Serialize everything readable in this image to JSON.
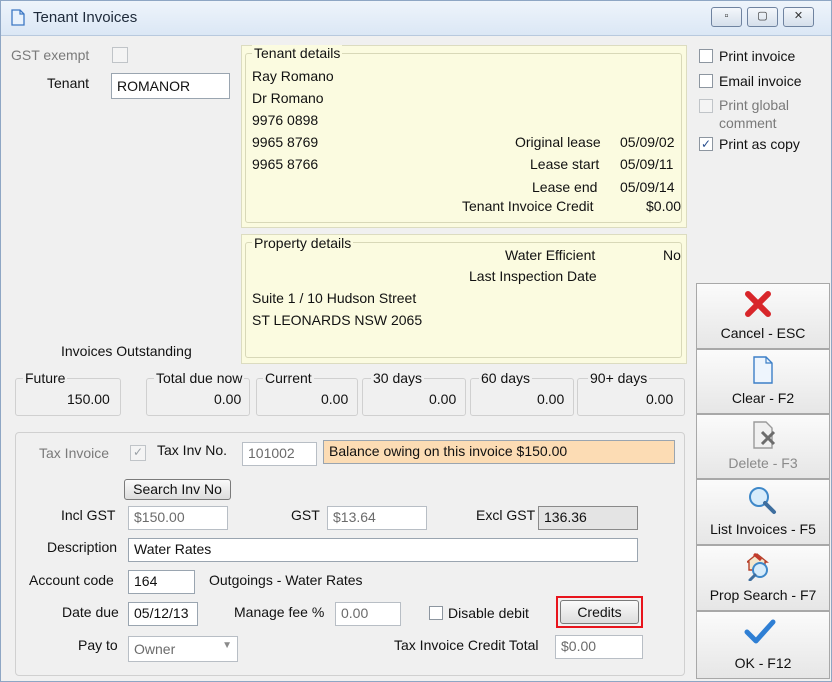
{
  "window": {
    "title": "Tenant Invoices",
    "controls": [
      "minimize",
      "restore",
      "close"
    ]
  },
  "gst_exempt": {
    "label": "GST exempt",
    "checked": false
  },
  "tenant": {
    "label": "Tenant",
    "value": "ROMANOR"
  },
  "tenant_details": {
    "heading": "Tenant details",
    "lines": [
      "Ray Romano",
      "Dr Romano",
      "9976 0898",
      "9965 8769",
      "9965 8766"
    ],
    "original_lease_label": "Original lease",
    "original_lease_value": "05/09/02",
    "lease_start_label": "Lease start",
    "lease_start_value": "05/09/11",
    "lease_end_label": "Lease end",
    "lease_end_value": "05/09/14",
    "credit_label": "Tenant Invoice Credit",
    "credit_value": "$0.00"
  },
  "property_details": {
    "heading": "Property details",
    "water_label": "Water Efficient",
    "water_value": "No",
    "inspection_label": "Last Inspection Date",
    "address_line1": "Suite 1 / 10 Hudson Street",
    "address_line2": "ST LEONARDS  NSW  2065"
  },
  "options": {
    "print_invoice": {
      "label": "Print invoice",
      "checked": false
    },
    "email_invoice": {
      "label": "Email invoice",
      "checked": false
    },
    "print_global_comment": {
      "label": "Print global comment",
      "line1": "Print global",
      "line2": "comment",
      "checked": false,
      "disabled": true
    },
    "print_as_copy": {
      "label": "Print as copy",
      "checked": true
    }
  },
  "invoices_outstanding": {
    "label": "Invoices Outstanding",
    "future_label": "Future",
    "future_value": "150.00",
    "total_label": "Total due now",
    "total_value": "0.00",
    "current_label": "Current",
    "current_value": "0.00",
    "d30_label": "30 days",
    "d30_value": "0.00",
    "d60_label": "60 days",
    "d60_value": "0.00",
    "d90_label": "90+ days",
    "d90_value": "0.00"
  },
  "invoice_form": {
    "tax_invoice_label": "Tax Invoice",
    "tax_invoice_checked": true,
    "tax_inv_no_label": "Tax Inv No.",
    "tax_inv_no_value": "101002",
    "balance_message": "Balance owing on this invoice $150.00",
    "search_button": "Search Inv No",
    "incl_gst_label": "Incl GST",
    "incl_gst_value": "$150.00",
    "gst_label": "GST",
    "gst_value": "$13.64",
    "excl_gst_label": "Excl GST",
    "excl_gst_value": "136.36",
    "description_label": "Description",
    "description_value": "Water Rates",
    "account_code_label": "Account code",
    "account_code_value": "164",
    "account_name": "Outgoings - Water Rates",
    "date_due_label": "Date due",
    "date_due_value": "05/12/13",
    "manage_fee_label": "Manage fee %",
    "manage_fee_value": "0.00",
    "disable_debit_label": "Disable debit",
    "disable_debit_checked": false,
    "credits_button": "Credits",
    "pay_to_label": "Pay to",
    "pay_to_value": "Owner",
    "credit_total_label": "Tax Invoice Credit Total",
    "credit_total_value": "$0.00"
  },
  "side_buttons": {
    "cancel": {
      "label": "Cancel - ESC",
      "icon": "red-x-icon"
    },
    "clear": {
      "label": "Clear - F2",
      "icon": "blank-page-icon"
    },
    "delete": {
      "label": "Delete - F3",
      "icon": "delete-page-icon",
      "disabled": true
    },
    "list": {
      "label": "List Invoices - F5",
      "icon": "magnifier-icon"
    },
    "prop_search": {
      "label": "Prop Search - F7",
      "icon": "house-search-icon"
    },
    "ok": {
      "label": "OK - F12",
      "icon": "checkmark-icon"
    }
  },
  "colors": {
    "highlight_border": "#e8141c",
    "info_bg": "#fbfbe0",
    "balance_bg": "#fcdcb4"
  }
}
